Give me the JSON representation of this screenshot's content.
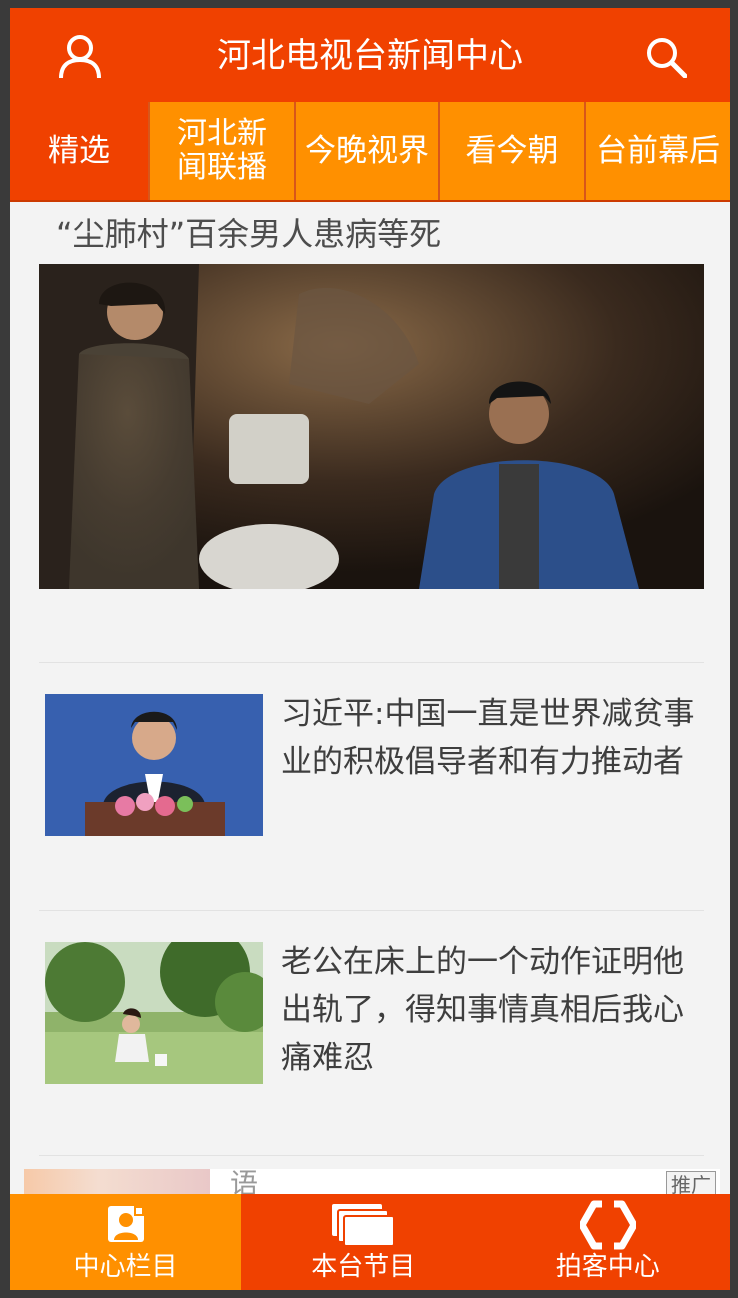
{
  "header": {
    "title": "河北电视台新闻中心",
    "bg_color": "#f04100"
  },
  "tabs": [
    {
      "label": "精选"
    },
    {
      "label": "河北新闻联播"
    },
    {
      "label": "今晚视界"
    },
    {
      "label": "看今朝"
    },
    {
      "label": "台前幕后"
    }
  ],
  "tab_bg_color": "#ff9000",
  "feature": {
    "title": "“尘肺村”百余男人患病等死",
    "title_color": "#4d4d4d",
    "image": "photo-two-people-dark-room"
  },
  "news": [
    {
      "headline": "习近平:中国一直是世界减贫事业的积极倡导者和有力推动者",
      "image": "photo-speaker-podium"
    },
    {
      "headline": "老公在床上的一个动作证明他出轨了，得知事情真相后我心痛难忍",
      "image": "photo-woman-garden"
    }
  ],
  "news_text_color": "#3e3e3e",
  "partial_item": {
    "text": "语",
    "ad_label": "推广"
  },
  "bottom_nav": [
    {
      "label": "中心栏目",
      "icon": "portrait-icon"
    },
    {
      "label": "本台节目",
      "icon": "stack-icon"
    },
    {
      "label": "拍客中心",
      "icon": "hexagon-logo-icon"
    }
  ],
  "bottom_active_color": "#ff9000",
  "background_color": "#f3f3f3"
}
